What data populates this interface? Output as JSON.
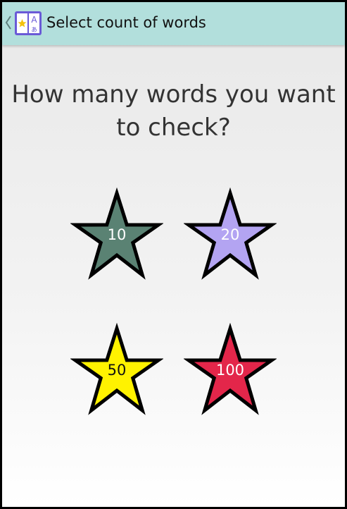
{
  "action_bar": {
    "title": "Select count of words",
    "back_icon": "chevron-left-icon",
    "app_icon": "flashcard-book-icon",
    "background": "#b2dfdc"
  },
  "question": {
    "line1": "How many words you want",
    "line2": "to check?"
  },
  "options": [
    {
      "label": "10",
      "icon": "star-icon",
      "color": "#5a8273",
      "text_color": "#ffffff"
    },
    {
      "label": "20",
      "icon": "star-icon",
      "color": "#b3a4f2",
      "text_color": "#ffffff"
    },
    {
      "label": "50",
      "icon": "star-icon",
      "color": "#fff200",
      "text_color": "#111111"
    },
    {
      "label": "100",
      "icon": "star-icon",
      "color": "#e3264a",
      "text_color": "#ffffff"
    }
  ]
}
